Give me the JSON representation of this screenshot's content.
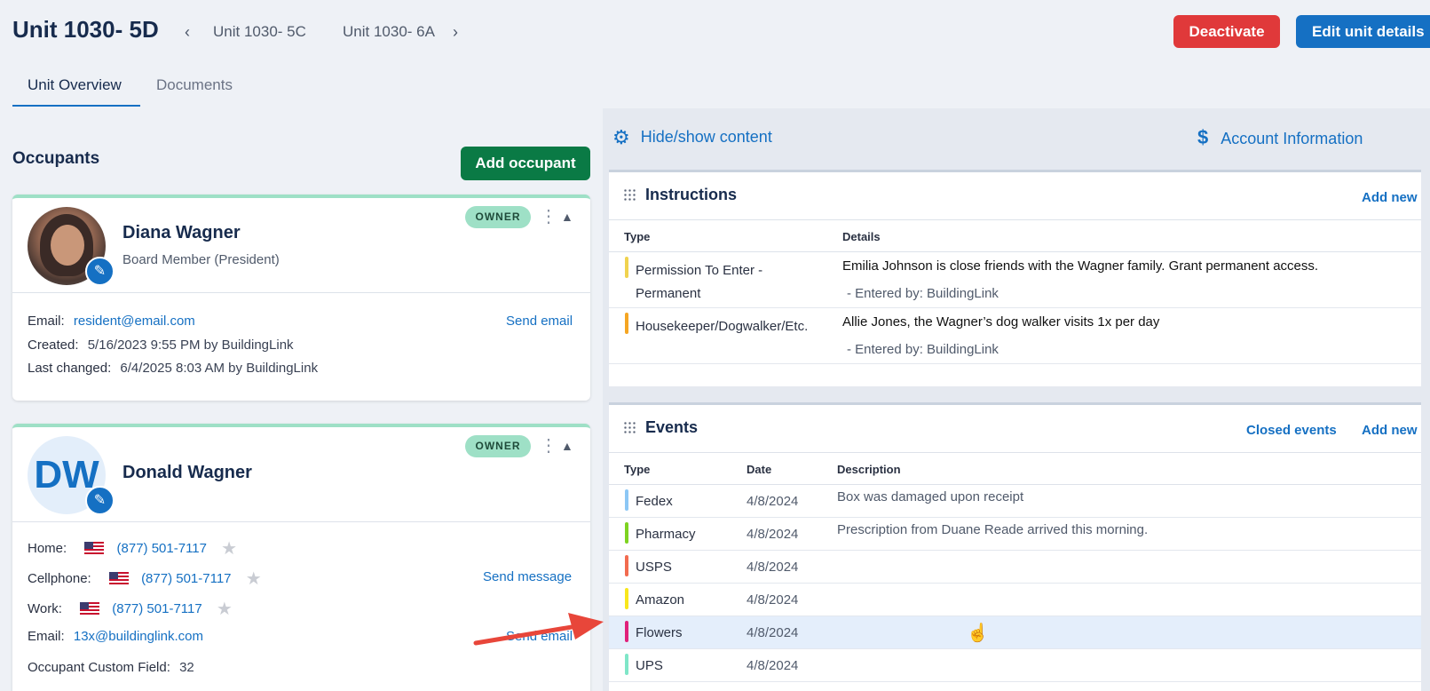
{
  "header": {
    "unit_title": "Unit 1030- 5D",
    "prev_unit": "Unit 1030- 5C",
    "next_unit": "Unit 1030- 6A",
    "deactivate_label": "Deactivate",
    "edit_label": "Edit unit details"
  },
  "tabs": [
    {
      "label": "Unit Overview",
      "active": true
    },
    {
      "label": "Documents",
      "active": false
    }
  ],
  "occupants": {
    "title": "Occupants",
    "add_label": "Add occupant",
    "list": [
      {
        "name": "Diana Wagner",
        "role": "Board Member (President)",
        "badge": "OWNER",
        "email_label": "Email:",
        "email": "resident@email.com",
        "send_email": "Send email",
        "created_label": "Created:",
        "created": "5/16/2023 9:55 PM by BuildingLink",
        "changed_label": "Last changed:",
        "changed": "6/4/2025 8:03 AM by BuildingLink"
      },
      {
        "name": "Donald Wagner",
        "initials": "DW",
        "badge": "OWNER",
        "home_label": "Home:",
        "home": "(877) 501-7117",
        "cell_label": "Cellphone:",
        "cell": "(877) 501-7117",
        "work_label": "Work:",
        "work": "(877) 501-7117",
        "send_message": "Send message",
        "email_label": "Email:",
        "email": "13x@buildinglink.com",
        "send_email": "Send email",
        "custom_label": "Occupant Custom Field:",
        "custom": "32"
      }
    ]
  },
  "right": {
    "hide_show": "Hide/show content",
    "account_info": "Account Information"
  },
  "instructions": {
    "title": "Instructions",
    "add_new": "Add new",
    "col_type": "Type",
    "col_details": "Details",
    "rows": [
      {
        "type_line1": "Permission To Enter -",
        "type_line2": "Permanent",
        "details": "Emilia Johnson is close friends with the Wagner family. Grant permanent access.",
        "entered": "- Entered by: BuildingLink",
        "color": "#f0d34f"
      },
      {
        "type_line1": "Housekeeper/Dogwalker/Etc.",
        "details": "Allie Jones, the Wagner’s dog walker visits 1x per day",
        "entered": "- Entered by: BuildingLink",
        "color": "#f5a623"
      }
    ]
  },
  "events": {
    "title": "Events",
    "closed_events": "Closed events",
    "add_new": "Add new",
    "col_type": "Type",
    "col_date": "Date",
    "col_desc": "Description",
    "rows": [
      {
        "type": "Fedex",
        "date": "4/8/2024",
        "desc": "Box was damaged upon receipt",
        "color": "#8cc7f5"
      },
      {
        "type": "Pharmacy",
        "date": "4/8/2024",
        "desc": "Prescription from Duane Reade arrived this morning.",
        "color": "#7ed321"
      },
      {
        "type": "USPS",
        "date": "4/8/2024",
        "desc": "",
        "color": "#f26b4f"
      },
      {
        "type": "Amazon",
        "date": "4/8/2024",
        "desc": "",
        "color": "#f8e71c"
      },
      {
        "type": "Flowers",
        "date": "4/8/2024",
        "desc": "",
        "color": "#e0217a"
      },
      {
        "type": "UPS",
        "date": "4/8/2024",
        "desc": "",
        "color": "#7fe6c8"
      }
    ]
  },
  "colors": {
    "accent": "#1570c3",
    "danger": "#e0393a",
    "success": "#0a7a45",
    "owner_badge": "#9ee0c6"
  }
}
